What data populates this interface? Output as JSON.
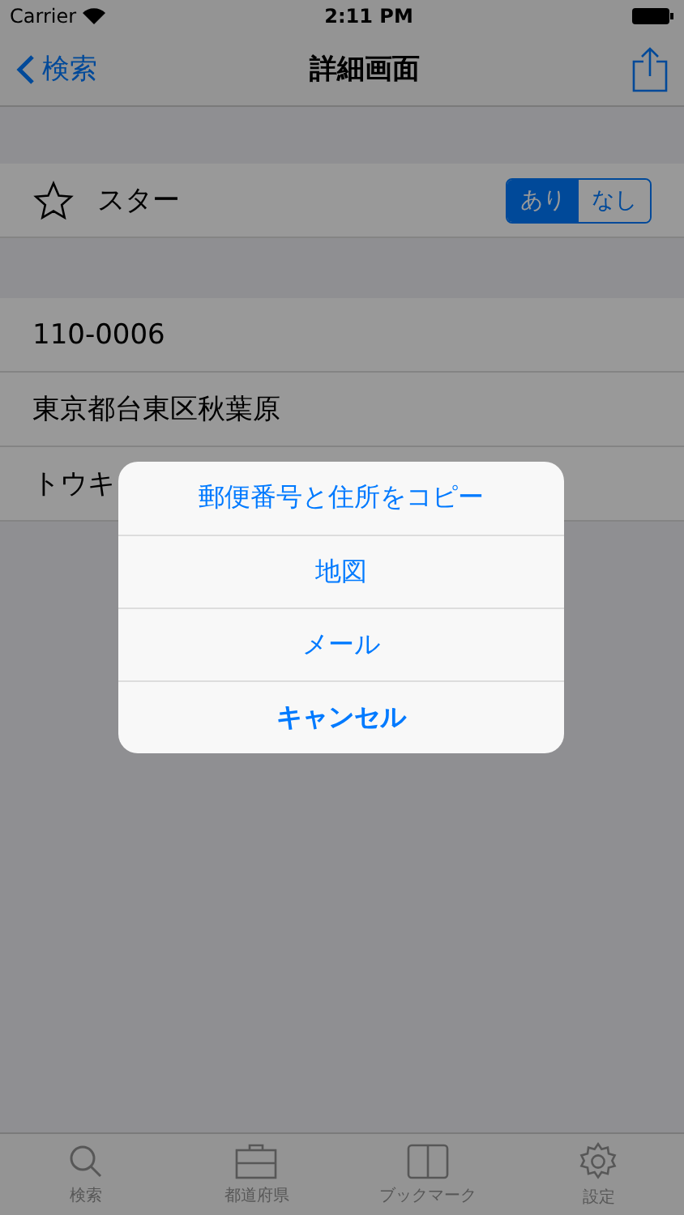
{
  "status_bar": {
    "carrier": "Carrier",
    "time": "2:11 PM"
  },
  "nav": {
    "back": "検索",
    "title": "詳細画面"
  },
  "star_row": {
    "label": "スター",
    "segments": [
      {
        "label": "あり",
        "selected": true
      },
      {
        "label": "なし",
        "selected": false
      }
    ]
  },
  "details": [
    "110-0006",
    "東京都台東区秋葉原",
    "トウキ"
  ],
  "alert": {
    "actions": [
      {
        "label": "郵便番号と住所をコピー",
        "kind": "action"
      },
      {
        "label": "地図",
        "kind": "action"
      },
      {
        "label": "メール",
        "kind": "action"
      },
      {
        "label": "キャンセル",
        "kind": "cancel"
      }
    ]
  },
  "tab_bar": [
    {
      "label": "検索",
      "kind": "search"
    },
    {
      "label": "都道府県",
      "kind": "briefcase"
    },
    {
      "label": "ブックマーク",
      "kind": "book"
    },
    {
      "label": "設定",
      "kind": "settings"
    }
  ]
}
